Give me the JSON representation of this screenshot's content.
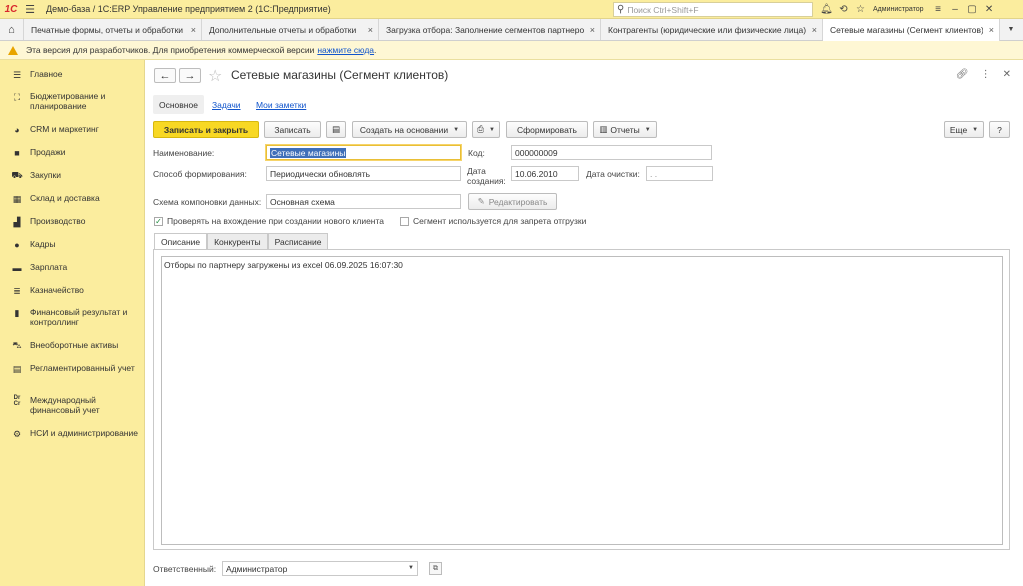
{
  "app": {
    "logo": "1С",
    "title": "Демо-база / 1С:ERP Управление предприятием 2  (1С:Предприятие)",
    "search_placeholder": "Поиск Ctrl+Shift+F",
    "user": "Администратор"
  },
  "window_tabs": [
    {
      "label": "Печатные формы, отчеты и обработки",
      "active": false
    },
    {
      "label": "Дополнительные отчеты и обработки",
      "active": false
    },
    {
      "label": "Загрузка отбора: Заполнение сегментов партнеров",
      "active": false
    },
    {
      "label": "Контрагенты (юридические или физические лица)",
      "active": false
    },
    {
      "label": "Сетевые магазины (Сегмент клиентов)",
      "active": true
    }
  ],
  "banner": {
    "text": "Эта версия для разработчиков. Для приобретения коммерческой версии",
    "link": "нажмите сюда",
    "suffix": "."
  },
  "sidebar": {
    "items": [
      {
        "label": "Главное",
        "icon": "menu-lines-icon"
      },
      {
        "label": "Бюджетирование и планирование",
        "icon": "chart-icon"
      },
      {
        "label": "CRM и маркетинг",
        "icon": "pie-icon"
      },
      {
        "label": "Продажи",
        "icon": "bag-icon"
      },
      {
        "label": "Закупки",
        "icon": "cart-icon"
      },
      {
        "label": "Склад и доставка",
        "icon": "warehouse-icon"
      },
      {
        "label": "Производство",
        "icon": "factory-icon"
      },
      {
        "label": "Кадры",
        "icon": "person-icon"
      },
      {
        "label": "Зарплата",
        "icon": "money-icon"
      },
      {
        "label": "Казначейство",
        "icon": "coins-icon"
      },
      {
        "label": "Финансовый результат и контроллинг",
        "icon": "bar-chart-icon"
      },
      {
        "label": "Внеоборотные активы",
        "icon": "car-icon"
      },
      {
        "label": "Регламентированный учет",
        "icon": "report-icon"
      },
      {
        "label": "Международный финансовый учет",
        "icon": "dr-cr-icon"
      },
      {
        "label": "НСИ и администрирование",
        "icon": "gear-icon"
      }
    ]
  },
  "form": {
    "title": "Сетевые магазины (Сегмент клиентов)",
    "subtabs": {
      "main": "Основное",
      "tasks": "Задачи",
      "notes": "Мои заметки"
    },
    "toolbar": {
      "save_close": "Записать и закрыть",
      "save": "Записать",
      "create_based": "Создать на основании",
      "generate": "Сформировать",
      "reports": "Отчеты",
      "more": "Еще",
      "help": "?"
    },
    "fields": {
      "name_label": "Наименование:",
      "name_value": "Сетевые магазины",
      "code_label": "Код:",
      "code_value": "000000009",
      "method_label": "Способ формирования:",
      "method_value": "Периодически обновлять",
      "created_label_1": "Дата",
      "created_label_2": "создания:",
      "created_value": "10.06.2010",
      "clear_label": "Дата очистки:",
      "clear_value": " .  .",
      "scheme_label": "Схема компоновки данных:",
      "scheme_value": "Основная схема",
      "edit_button": "Редактировать"
    },
    "checkboxes": {
      "check_entry": {
        "label": "Проверять на вхождение при создании нового клиента",
        "checked": true
      },
      "ship_ban": {
        "label": "Сегмент используется для запрета отгрузки",
        "checked": false
      }
    },
    "panel_tabs": [
      "Описание",
      "Конкуренты",
      "Расписание"
    ],
    "description": "Отборы по партнеру загружены из excel 06.09.2025 16:07:30",
    "responsible_label": "Ответственный:",
    "responsible_value": "Администратор"
  }
}
